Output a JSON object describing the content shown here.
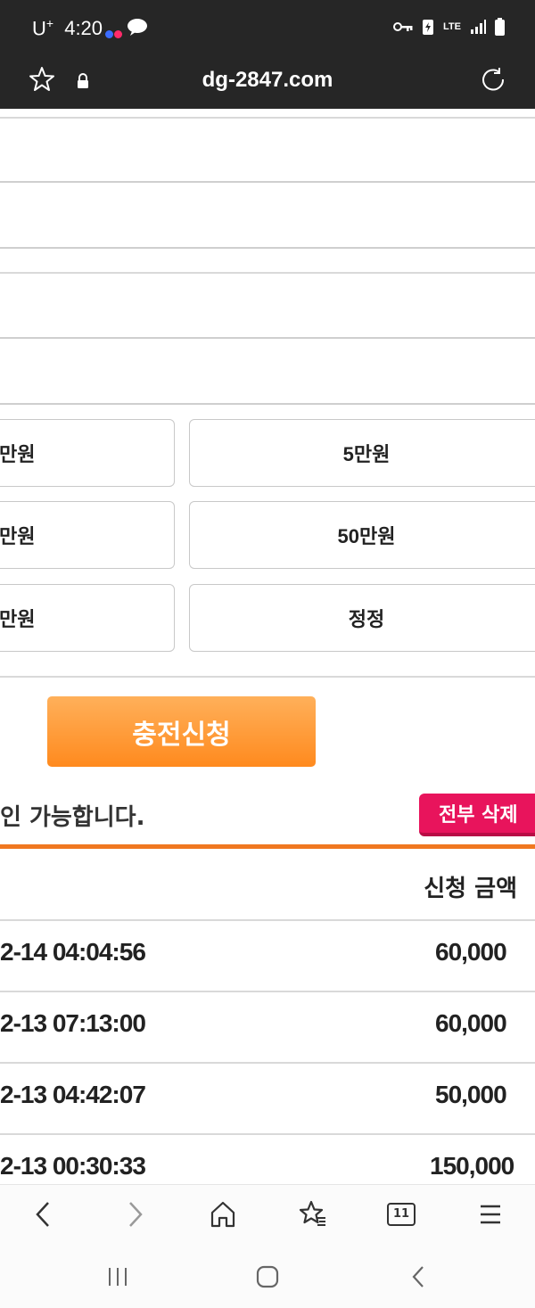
{
  "status_bar": {
    "carrier": "U",
    "carrier_sup": "+",
    "time": "4:20",
    "net": "LTE"
  },
  "browser": {
    "url": "dg-2847.com"
  },
  "amount_buttons": {
    "left": [
      "만원",
      "만원",
      "만원"
    ],
    "right": [
      "5만원",
      "50만원",
      "정정"
    ]
  },
  "submit": {
    "label": "충전신청"
  },
  "history": {
    "notice": "인 가능합니다.",
    "delete_all_label": "전부 삭제",
    "col_amount": "신청 금액",
    "rows": [
      {
        "date": "2-14 04:04:56",
        "amount": "60,000"
      },
      {
        "date": "2-13 07:13:00",
        "amount": "60,000"
      },
      {
        "date": "2-13 04:42:07",
        "amount": "50,000"
      },
      {
        "date": "2-13 00:30:33",
        "amount": "150,000"
      }
    ]
  },
  "bottom_nav": {
    "tabs_count": "11"
  },
  "colors": {
    "accent_orange": "#ff8a1e",
    "delete_pink": "#e8145c"
  }
}
